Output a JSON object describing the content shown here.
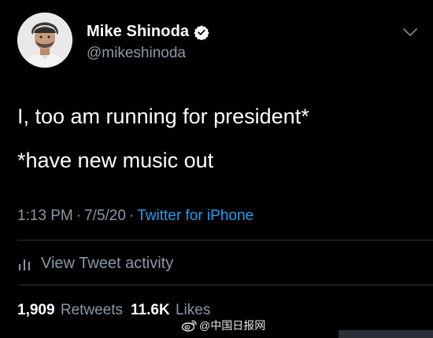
{
  "author": {
    "name": "Mike Shinoda",
    "handle": "@mikeshinoda"
  },
  "tweet": {
    "line1": "I, too am running for president*",
    "line2": "*have new music out"
  },
  "meta": {
    "time": "1:13 PM",
    "separator": "·",
    "date": "7/5/20",
    "source": "Twitter for iPhone"
  },
  "activity": {
    "label": "View Tweet activity"
  },
  "stats": {
    "retweets_count": "1,909",
    "retweets_label": "Retweets",
    "likes_count": "11.6K",
    "likes_label": "Likes"
  },
  "watermark": {
    "text": "@中国日报网"
  },
  "colors": {
    "background": "#000000",
    "secondary_text": "#8b98a5",
    "link": "#1da1f2",
    "verified_badge": "#ffffff"
  },
  "icons": [
    "verified-icon",
    "chevron-down-icon",
    "activity-chart-icon",
    "weibo-logo-icon"
  ]
}
